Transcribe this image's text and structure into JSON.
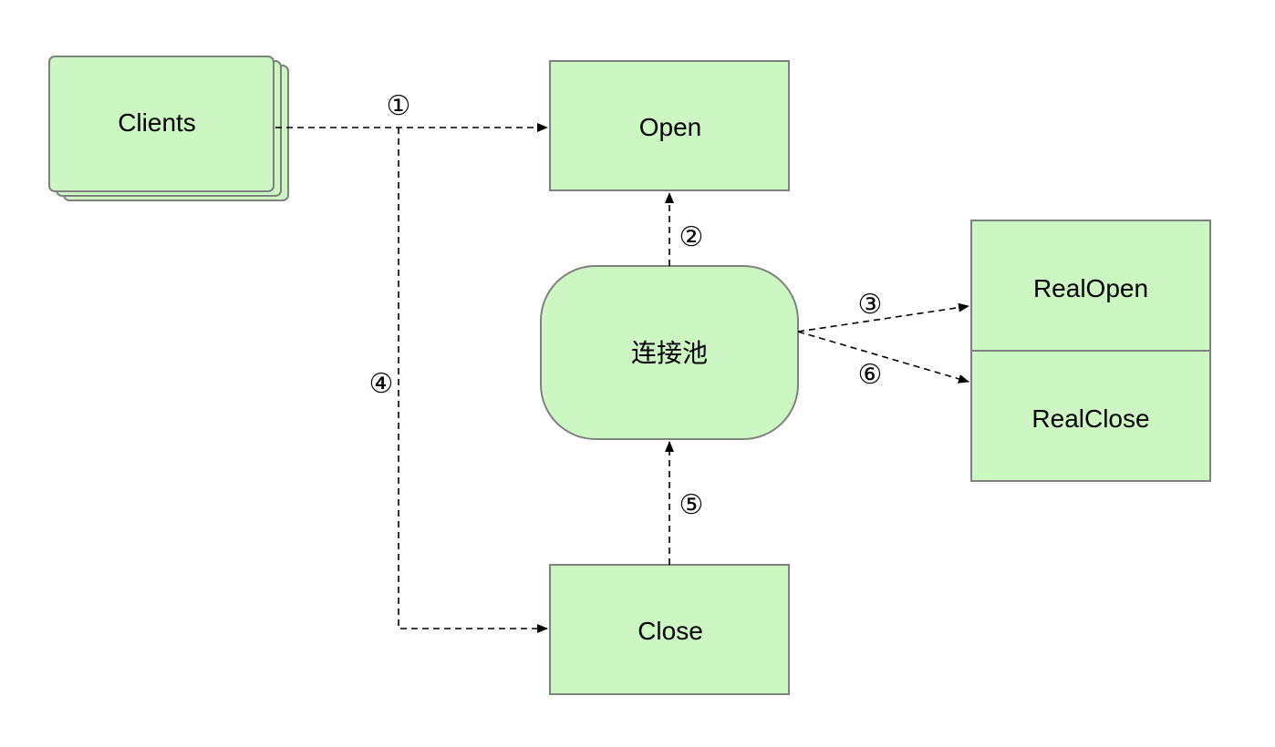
{
  "nodes": {
    "clients": {
      "label": "Clients"
    },
    "open": {
      "label": "Open"
    },
    "pool": {
      "label": "连接池"
    },
    "real_open": {
      "label": "RealOpen"
    },
    "real_close": {
      "label": "RealClose"
    },
    "close": {
      "label": "Close"
    }
  },
  "steps": {
    "s1": "①",
    "s2": "②",
    "s3": "③",
    "s4": "④",
    "s5": "⑤",
    "s6": "⑥"
  },
  "colors": {
    "node_fill": "#ccf7c3",
    "node_stroke": "#808080",
    "edge": "#000000"
  }
}
